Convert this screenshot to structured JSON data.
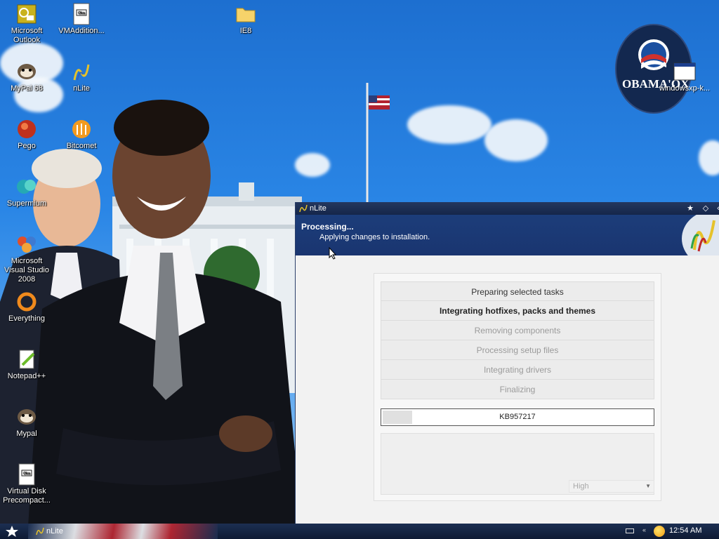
{
  "desktop": {
    "icons": [
      {
        "label": "Microsoft Outlook",
        "icon": "outlook-icon"
      },
      {
        "label": "VMAddition...",
        "icon": "document-icon"
      },
      {
        "label": "IE8",
        "icon": "folder-icon"
      },
      {
        "label": "MyPal 68",
        "icon": "mypal-icon"
      },
      {
        "label": "nLite",
        "icon": "nlite-icon"
      },
      {
        "label": "Pego",
        "icon": "pego-icon"
      },
      {
        "label": "Bitcomet",
        "icon": "bitcomet-icon"
      },
      {
        "label": "Supermium",
        "icon": "supermium-icon"
      },
      {
        "label": "Microsoft Visual Studio 2008",
        "icon": "visual-studio-icon"
      },
      {
        "label": "Everything",
        "icon": "everything-icon"
      },
      {
        "label": "Notepad++",
        "icon": "notepadpp-icon"
      },
      {
        "label": "Mypal",
        "icon": "mypal-icon"
      },
      {
        "label": "Virtual Disk Precompact...",
        "icon": "document-icon"
      },
      {
        "label": "windowsxp-k...",
        "icon": "window-icon"
      }
    ],
    "logo_text": "OBAMA'OX"
  },
  "window": {
    "title": "nLite",
    "header_title": "Processing...",
    "header_subtitle": "Applying changes to installation.",
    "tasks": [
      {
        "label": "Preparing selected tasks",
        "state": "done"
      },
      {
        "label": "Integrating hotfixes, packs and themes",
        "state": "active"
      },
      {
        "label": "Removing components",
        "state": "pending"
      },
      {
        "label": "Processing setup files",
        "state": "pending"
      },
      {
        "label": "Integrating drivers",
        "state": "pending"
      },
      {
        "label": "Finalizing",
        "state": "pending"
      }
    ],
    "progress": {
      "label": "KB957217",
      "fraction": 0.11
    },
    "priority": {
      "selected": "High"
    }
  },
  "taskbar": {
    "task_label": "nLite",
    "clock": "12:54 AM"
  },
  "colors": {
    "title_bar": "#15264a",
    "header": "#1c3d7a",
    "body": "#f2f2f2"
  }
}
